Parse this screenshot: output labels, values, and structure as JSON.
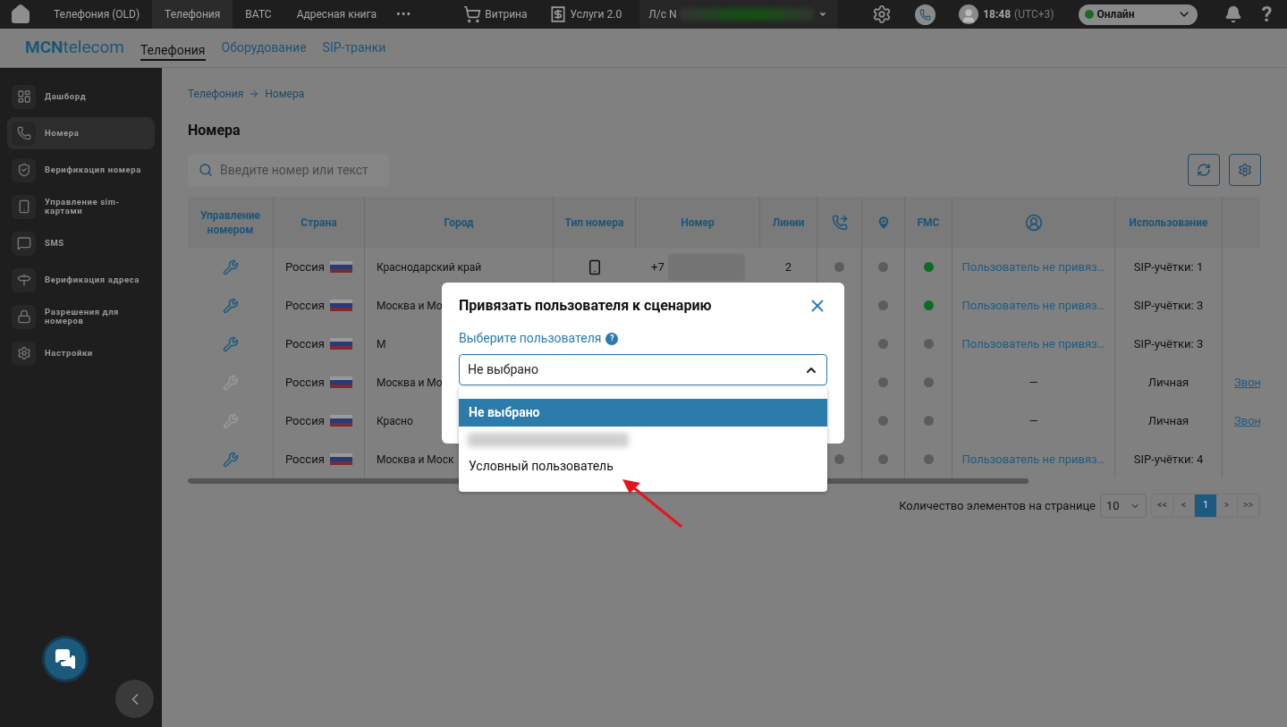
{
  "topbar": {
    "tabs": [
      {
        "label": "Телефония (OLD)",
        "selected": false
      },
      {
        "label": "Телефония",
        "selected": true
      },
      {
        "label": "ВАТС",
        "selected": false
      },
      {
        "label": "Адресная книга",
        "selected": false
      }
    ],
    "more": "•••",
    "links": [
      {
        "label": "Витрина",
        "kind": "cart"
      },
      {
        "label": "Услуги 2.0",
        "kind": "services"
      }
    ],
    "account": "Л/с N",
    "time": "18:48",
    "timezone": "(UTC+3)",
    "status": {
      "label": "Онлайн",
      "color": "#166b2a"
    },
    "help": "?"
  },
  "subnav": {
    "logo": "**MCN**telecom",
    "tabs": [
      {
        "label": "Телефония",
        "selected": true
      },
      {
        "label": "Оборудование",
        "selected": false
      },
      {
        "label": "SIP-транки",
        "selected": false
      }
    ]
  },
  "sidebar": {
    "items": [
      {
        "label": "Дашборд",
        "kind": "dashboard",
        "selected": false
      },
      {
        "label": "Номера",
        "kind": "phone",
        "selected": true
      },
      {
        "label": "Верификация номера",
        "kind": "verify",
        "selected": false
      },
      {
        "label": "Управление sim-картами",
        "kind": "sim",
        "selected": false
      },
      {
        "label": "SMS",
        "kind": "sms",
        "selected": false
      },
      {
        "label": "Верификация адреса",
        "kind": "signpost",
        "selected": false
      },
      {
        "label": "Разрешения для номеров",
        "kind": "lock",
        "selected": false
      },
      {
        "label": "Настройки",
        "kind": "settings",
        "selected": false
      }
    ]
  },
  "breadcrumb": [
    "Телефония",
    "Номера"
  ],
  "page_title": "Номера",
  "search": {
    "placeholder": "Введите номер или текст"
  },
  "table": {
    "columns": [
      {
        "kind": "text",
        "label": "Управление номером"
      },
      {
        "kind": "text",
        "label": "Страна"
      },
      {
        "kind": "text",
        "label": "Город"
      },
      {
        "kind": "text",
        "label": "Тип номера"
      },
      {
        "kind": "text",
        "label": "Номер"
      },
      {
        "kind": "text",
        "label": "Линии"
      },
      {
        "kind": "forward"
      },
      {
        "kind": "location"
      },
      {
        "kind": "text",
        "label": "FMC"
      },
      {
        "kind": "user"
      },
      {
        "kind": "text",
        "label": "Использование"
      }
    ],
    "rows": [
      {
        "manage_enabled": true,
        "country": "Россия",
        "city": "Краснодарский край",
        "mobile": true,
        "number": "+7",
        "lines": "2",
        "forward": {
          "color": "#5c5c5c"
        },
        "location": {
          "color": "#5c5c5c"
        },
        "fmc": {
          "color": "#0f6b22"
        },
        "user": {
          "kind": "link",
          "text": "Пользователь не привяз…"
        },
        "usage": "SIP-учётки: 1"
      },
      {
        "manage_enabled": true,
        "country": "Россия",
        "city": "Москва и Мо",
        "location": {
          "color": "#5c5c5c"
        },
        "fmc": {
          "color": "#0f6b22"
        },
        "user": {
          "kind": "link",
          "text": "Пользователь не привяз…"
        },
        "usage": "SIP-учётки: 3"
      },
      {
        "manage_enabled": true,
        "country": "Россия",
        "city": "М",
        "location": {
          "color": "#5c5c5c"
        },
        "fmc": {
          "color": "#5c5c5c"
        },
        "user": {
          "kind": "link",
          "text": "Пользователь не привяз…"
        },
        "usage": "SIP-учётки: 3"
      },
      {
        "manage_enabled": false,
        "country": "Россия",
        "city": "Москва и Мо",
        "location": {
          "color": "#5c5c5c"
        },
        "fmc": {
          "color": "#5c5c5c"
        },
        "user": {
          "kind": "plain",
          "text": "—"
        },
        "usage": "Личная",
        "call": "Звон"
      },
      {
        "manage_enabled": false,
        "country": "Россия",
        "city": "Красно",
        "location": {
          "color": "#5c5c5c"
        },
        "fmc": {
          "color": "#5c5c5c"
        },
        "user": {
          "kind": "plain",
          "text": "—"
        },
        "usage": "Личная",
        "call": "Звон"
      },
      {
        "manage_enabled": true,
        "country": "Россия",
        "city": "Москва и Моск",
        "forward": {
          "color": "#5c5c5c"
        },
        "location": {
          "color": "#5c5c5c"
        },
        "fmc": {
          "color": "#5c5c5c"
        },
        "user": {
          "kind": "link",
          "text": "Пользователь не привяз…"
        },
        "usage": "SIP-учётки: 4"
      }
    ]
  },
  "pagination": {
    "label": "Количество элементов на странице",
    "page_size": "10",
    "pages": [
      {
        "label": "<<",
        "selected": false
      },
      {
        "label": "<",
        "selected": false
      },
      {
        "label": "1",
        "selected": true
      },
      {
        "label": ">",
        "selected": false
      },
      {
        "label": ">>",
        "selected": false
      }
    ]
  },
  "modal": {
    "title": "Привязать пользователя к сценарию",
    "label": "Выберите пользователя",
    "help": "?",
    "value": "Не выбрано",
    "expanded": true,
    "options": [
      {
        "kind": "text",
        "label": "Не выбрано",
        "selected": true
      },
      {
        "kind": "blurred",
        "selected": false
      },
      {
        "kind": "text",
        "label": "Условный пользователь",
        "selected": false
      }
    ]
  },
  "annotation": {
    "kind": "arrow",
    "color": "#e8141b"
  }
}
